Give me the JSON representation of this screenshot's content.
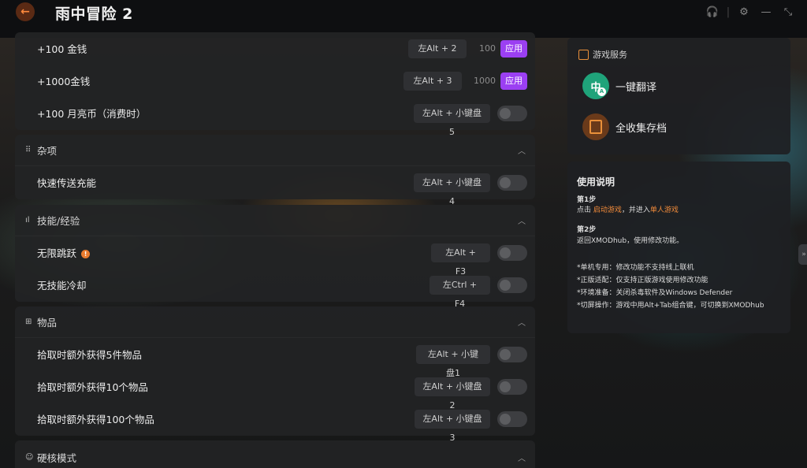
{
  "app": {
    "title": "雨中冒险 2"
  },
  "money": {
    "rows": [
      {
        "label": "+100 金钱",
        "hotkey": "左Alt + 2",
        "amount": "100",
        "apply": "应用"
      },
      {
        "label": "+1000金钱",
        "hotkey": "左Alt + 3",
        "amount": "1000",
        "apply": "应用"
      },
      {
        "label": "+100 月亮币（消费时）",
        "hotkey": "左Alt + 小键盘5"
      }
    ]
  },
  "misc": {
    "title": "杂项",
    "rows": [
      {
        "label": "快速传送充能",
        "hotkey": "左Alt + 小键盘4"
      }
    ]
  },
  "skills": {
    "title": "技能/经验",
    "rows": [
      {
        "label": "无限跳跃",
        "hotkey": "左Alt + F3"
      },
      {
        "label": "无技能冷却",
        "hotkey": "左Ctrl + F4"
      }
    ]
  },
  "items": {
    "title": "物品",
    "rows": [
      {
        "label": "拾取时额外获得5件物品",
        "hotkey": "左Alt + 小键盘1"
      },
      {
        "label": "拾取时额外获得10个物品",
        "hotkey": "左Alt + 小键盘2"
      },
      {
        "label": "拾取时额外获得100个物品",
        "hotkey": "左Alt + 小键盘3"
      }
    ]
  },
  "hardcore": {
    "title": "硬核模式"
  },
  "services": {
    "title": "游戏服务",
    "translate": "一键翻译",
    "translate_icon_text": "中",
    "translate_icon_sub": "A",
    "saves": "全收集存档"
  },
  "help": {
    "title": "使用说明",
    "step1_title": "第1步",
    "step1_pre": "点击 ",
    "step1_link1": "启动游戏",
    "step1_mid": "，并进入",
    "step1_link2": "单人游戏",
    "step2_title": "第2步",
    "step2_text": "返回XMODhub，使用修改功能。",
    "notes": [
      "*单机专用：修改功能不支持线上联机",
      "*正版适配：仅支持正版游戏使用修改功能",
      "*环境准备：关闭杀毒软件及Windows Defender",
      "*切屏操作：游戏中用Alt+Tab组合键，可切换到XMODhub"
    ]
  },
  "colors": {
    "accent": "#e9903a",
    "apply": "#9b3ff2",
    "translate": "#1fa37a",
    "saves": "#c46a2a"
  }
}
